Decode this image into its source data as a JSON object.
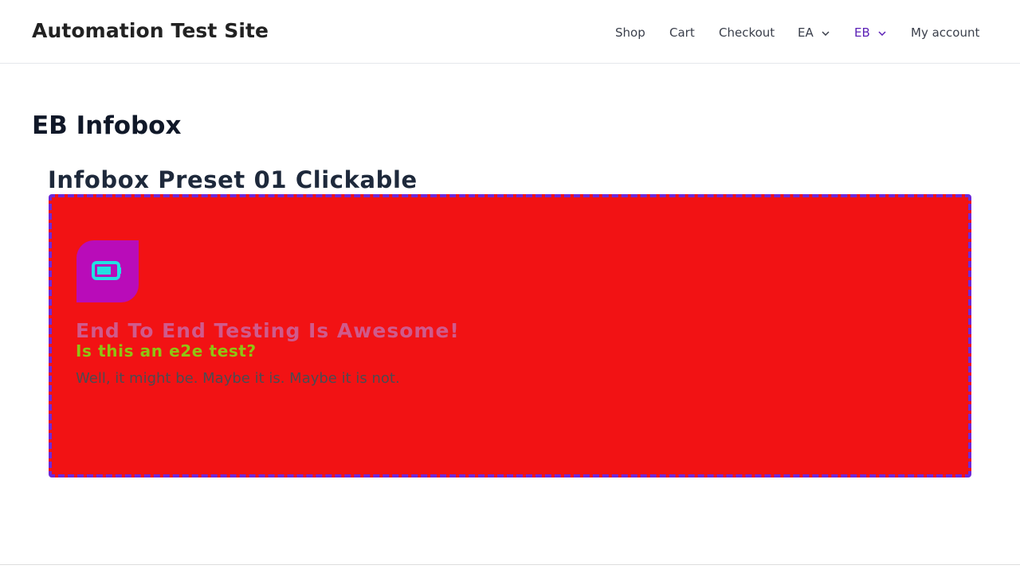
{
  "header": {
    "site_title": "Automation Test Site",
    "nav": {
      "shop": "Shop",
      "cart": "Cart",
      "checkout": "Checkout",
      "ea": "EA",
      "eb": "EB",
      "my_account": "My account"
    },
    "active_color": "#5b21b6"
  },
  "page": {
    "title": "EB Infobox",
    "section_title": "Infobox Preset 01 Clickable"
  },
  "infobox": {
    "icon": "battery-icon",
    "title": "End To End Testing Is Awesome!",
    "subtitle": "Is this an e2e test?",
    "description": "Well, it might be. Maybe it is. Maybe it is not.",
    "colors": {
      "background": "#f21214",
      "border": "#6d28d9",
      "icon_background": "#b90cb9",
      "icon": "#22e1e1",
      "title": "#d05a8c",
      "subtitle": "#8fc413"
    }
  }
}
